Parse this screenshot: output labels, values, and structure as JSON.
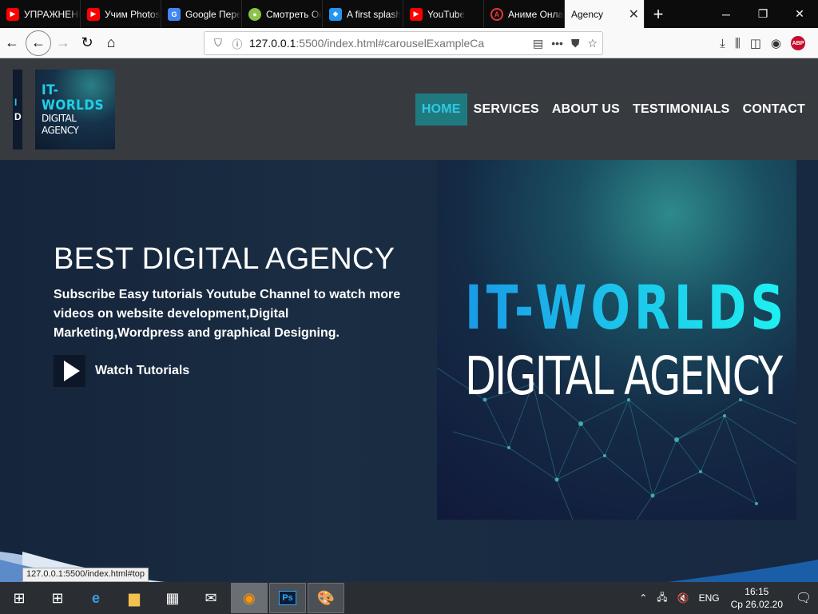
{
  "browser": {
    "tabs": [
      {
        "label": "УПРАЖНЕНИ",
        "favicon": "youtube-icon",
        "color": "#ff0000"
      },
      {
        "label": "Учим Photoshop",
        "favicon": "youtube-icon",
        "color": "#ff0000"
      },
      {
        "label": "Google Переводчик",
        "favicon": "google-translate-icon",
        "color": "#4285f4"
      },
      {
        "label": "Смотреть Онлайн",
        "favicon": "site-icon",
        "color": "#8bc34a"
      },
      {
        "label": "A first splash",
        "favicon": "site-icon",
        "color": "#2196f3"
      },
      {
        "label": "YouTube",
        "favicon": "youtube-icon",
        "color": "#ff0000"
      },
      {
        "label": "Аниме Онлайн",
        "favicon": "anime-icon",
        "color": "#e53935"
      }
    ],
    "active_tab": {
      "label": "Agency"
    },
    "url": {
      "host": "127.0.0.1",
      "path": ":5500/index.html#carouselExampleCa"
    },
    "status_url": "127.0.0.1:5500/index.html#top"
  },
  "site": {
    "logo": {
      "line1": "IT-WORLDS",
      "line2": "DIGITAL AGENCY"
    },
    "menu": [
      {
        "label": "HOME",
        "active": true
      },
      {
        "label": "SERVICES",
        "active": false
      },
      {
        "label": "ABOUT US",
        "active": false
      },
      {
        "label": "TESTIMONIALS",
        "active": false
      },
      {
        "label": "CONTACT",
        "active": false
      }
    ],
    "hero": {
      "title": "BEST DIGITAL AGENCY",
      "text": "Subscribe Easy tutorials Youtube Channel to watch more videos on website development,Digital Marketing,Wordpress and graphical Designing.",
      "cta": "Watch Tutorials",
      "image": {
        "line1": "IT-WORLDS",
        "line2": "DIGITAL AGENCY"
      }
    },
    "colors": {
      "accent": "#2ec9e3",
      "active_bg": "#1f7a80",
      "header_bg": "#373b40"
    }
  },
  "taskbar": {
    "lang": "ENG",
    "time": "16:15",
    "date": "Ср 26.02.20"
  }
}
